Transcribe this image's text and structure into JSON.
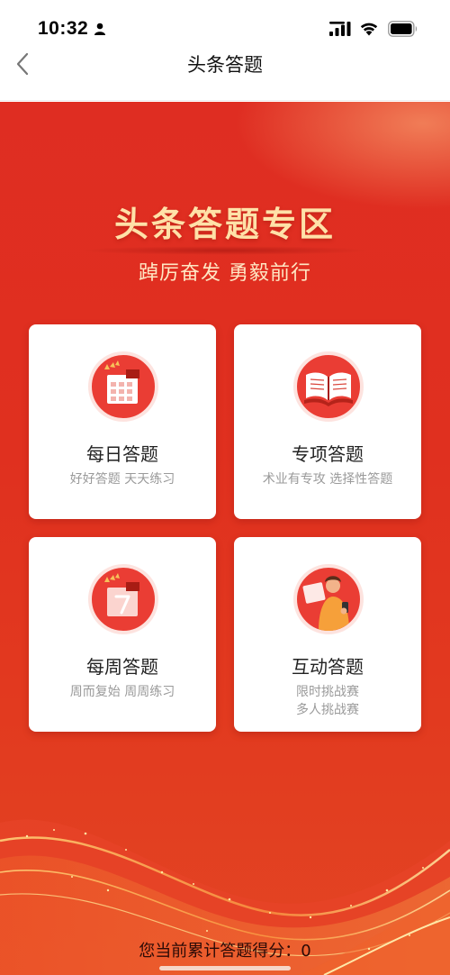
{
  "status": {
    "time": "10:32"
  },
  "nav": {
    "title": "头条答题"
  },
  "hero": {
    "title": "头条答题专区",
    "subtitle": "踔厉奋发 勇毅前行"
  },
  "cards": [
    {
      "title": "每日答题",
      "subtitle": "好好答题 天天练习",
      "icon": "calendar-icon"
    },
    {
      "title": "专项答题",
      "subtitle": "术业有专攻 选择性答题",
      "icon": "book-icon"
    },
    {
      "title": "每周答题",
      "subtitle": "周而复始 周周练习",
      "icon": "calendar-7-icon"
    },
    {
      "title": "互动答题",
      "subtitle_line1": "限时挑战赛",
      "subtitle_line2": "多人挑战赛",
      "icon": "person-phone-icon"
    }
  ],
  "footer": {
    "score_text": "您当前累计答题得分：0"
  },
  "colors": {
    "primary_red": "#e0301f",
    "hero_gold": "#ffe1a8",
    "icon_red": "#ea3d34"
  }
}
